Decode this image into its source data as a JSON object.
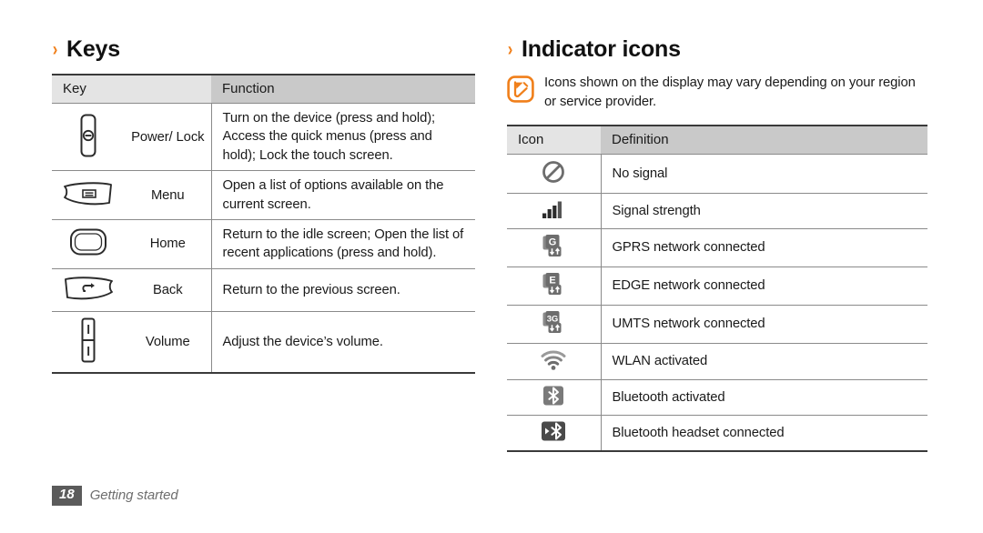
{
  "left_section": {
    "chevron": "›",
    "heading": "Keys",
    "table": {
      "headers": [
        "Key",
        "Function"
      ],
      "rows": [
        {
          "icon": "power-key-icon",
          "label": "Power/ Lock",
          "function": "Turn on the device (press and hold); Access the quick menus (press and hold); Lock the touch screen."
        },
        {
          "icon": "menu-key-icon",
          "label": "Menu",
          "function": "Open a list of options available on the current screen."
        },
        {
          "icon": "home-key-icon",
          "label": "Home",
          "function": "Return to the idle screen; Open the list of recent applications (press and hold)."
        },
        {
          "icon": "back-key-icon",
          "label": "Back",
          "function": "Return to the previous screen."
        },
        {
          "icon": "volume-key-icon",
          "label": "Volume",
          "function": "Adjust the device’s volume."
        }
      ]
    }
  },
  "right_section": {
    "chevron": "›",
    "heading": "Indicator icons",
    "note": {
      "icon": "note-pen-icon",
      "text": "Icons shown on the display may vary depending on your region or service provider."
    },
    "table": {
      "headers": [
        "Icon",
        "Definition"
      ],
      "rows": [
        {
          "icon": "no-signal-icon",
          "definition": "No signal"
        },
        {
          "icon": "signal-strength-icon",
          "definition": "Signal strength"
        },
        {
          "icon": "gprs-network-icon",
          "definition": "GPRS network connected"
        },
        {
          "icon": "edge-network-icon",
          "definition": "EDGE network connected"
        },
        {
          "icon": "umts-network-icon",
          "definition": "UMTS network connected"
        },
        {
          "icon": "wlan-icon",
          "definition": "WLAN activated"
        },
        {
          "icon": "bluetooth-icon",
          "definition": "Bluetooth activated"
        },
        {
          "icon": "bluetooth-headset-icon",
          "definition": "Bluetooth headset connected"
        }
      ]
    }
  },
  "footer": {
    "page_number": "18",
    "chapter": "Getting started"
  },
  "colors": {
    "accent": "#f07f1a",
    "header_cell": "#c9c9c9",
    "header_cell_light": "#e4e4e4",
    "footer_box": "#5b5b5b",
    "footer_text": "#6e6e6e",
    "icon_gray": "#6d6d6d"
  }
}
